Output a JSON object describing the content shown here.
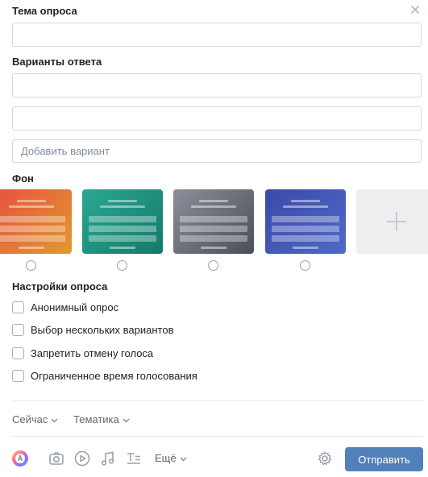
{
  "poll": {
    "topic_label": "Тема опроса",
    "topic_value": "",
    "options_label": "Варианты ответа",
    "option_values": [
      "",
      ""
    ],
    "add_option_placeholder": "Добавить вариант",
    "background_label": "Фон",
    "backgrounds": [
      {
        "name": "orange-red",
        "from": "#e8503f",
        "to": "#e09a2e"
      },
      {
        "name": "teal",
        "from": "#2aa892",
        "to": "#147a6a"
      },
      {
        "name": "grey",
        "from": "#8a8f99",
        "to": "#4a4f5a"
      },
      {
        "name": "blue",
        "from": "#3c49a8",
        "to": "#4e6ac8"
      }
    ],
    "settings_label": "Настройки опроса",
    "settings": [
      {
        "label": "Анонимный опрос",
        "checked": false
      },
      {
        "label": "Выбор нескольких вариантов",
        "checked": false
      },
      {
        "label": "Запретить отмену голоса",
        "checked": false
      },
      {
        "label": "Ограниченное время голосования",
        "checked": false
      }
    ]
  },
  "footer": {
    "time_dropdown": "Сейчас",
    "topic_dropdown": "Тематика",
    "more_label": "Ещё",
    "send_label": "Отправить"
  },
  "colors": {
    "accent": "#5181b8",
    "border": "#d3d9de",
    "muted_text": "#818c99"
  }
}
